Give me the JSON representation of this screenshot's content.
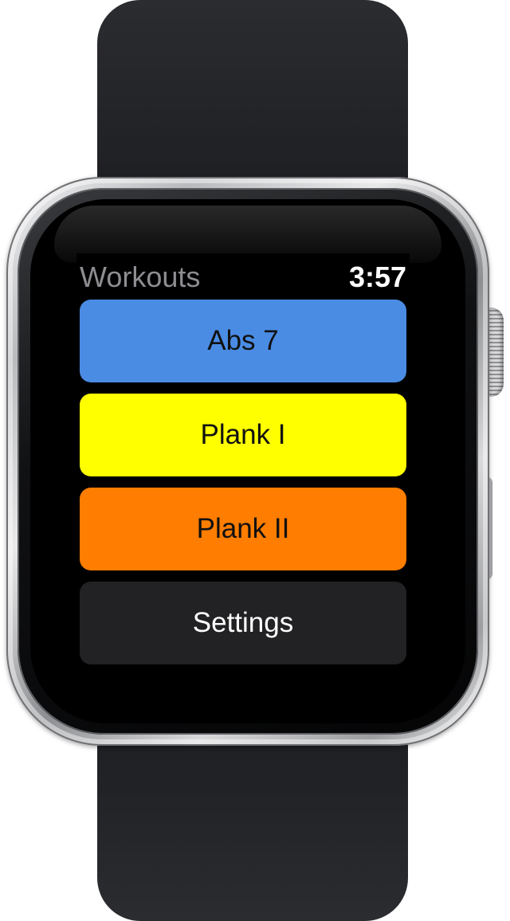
{
  "status_bar": {
    "title": "Workouts",
    "time": "3:57"
  },
  "workouts": [
    {
      "label": "Abs 7",
      "color": "#4a8ce4"
    },
    {
      "label": "Plank I",
      "color": "#ffff00"
    },
    {
      "label": "Plank II",
      "color": "#ff7d00"
    }
  ],
  "settings": {
    "label": "Settings",
    "color": "#222224"
  },
  "device": {
    "band_color": "#232427",
    "case_color": "#c8c9cb"
  }
}
